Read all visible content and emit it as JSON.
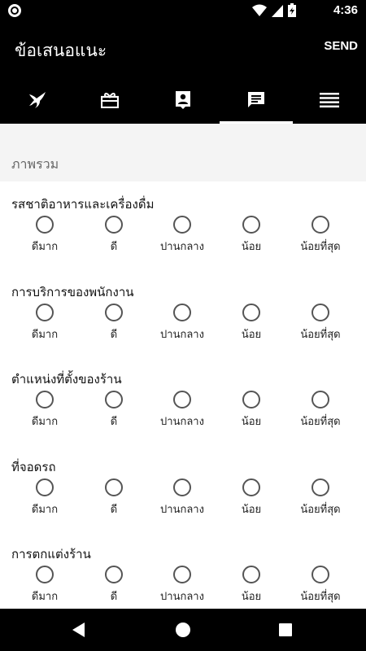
{
  "status_bar": {
    "time": "4:36",
    "icons": [
      "notification-circle-icon",
      "wifi-icon",
      "signal-icon",
      "battery-charging-icon"
    ]
  },
  "app_bar": {
    "title": "ข้อเสนอแนะ",
    "send_label": "SEND"
  },
  "tabs": [
    {
      "icon": "bird-logo-icon",
      "active": false
    },
    {
      "icon": "gift-card-icon",
      "active": false
    },
    {
      "icon": "contact-card-icon",
      "active": false
    },
    {
      "icon": "message-icon",
      "active": true
    },
    {
      "icon": "menu-lines-icon",
      "active": false
    }
  ],
  "section": {
    "title": "ภาพรวม"
  },
  "options": [
    "ดีมาก",
    "ดี",
    "ปานกลาง",
    "น้อย",
    "น้อยที่สุด"
  ],
  "questions": [
    {
      "title": "รสชาติอาหารและเครื่องดื่ม"
    },
    {
      "title": "การบริการของพนักงาน"
    },
    {
      "title": "ตำแหน่งที่ตั้งของร้าน"
    },
    {
      "title": "ที่จอดรถ"
    },
    {
      "title": "การตกแต่งร้าน"
    }
  ],
  "nav_bar": {
    "icons": [
      "back-icon",
      "home-icon",
      "recent-apps-icon"
    ]
  }
}
